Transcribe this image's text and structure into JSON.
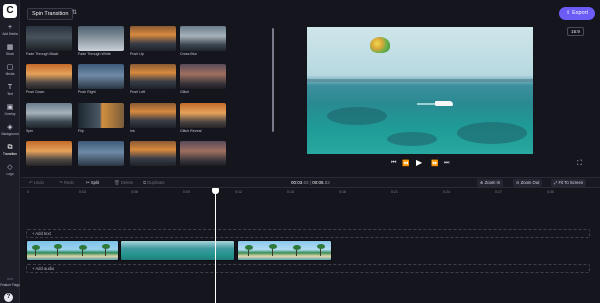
{
  "app": {
    "logo": "C"
  },
  "rail": {
    "items": [
      {
        "label": "Add Media",
        "icon": "+"
      },
      {
        "label": "Stock",
        "icon": "▦"
      },
      {
        "label": "Media",
        "icon": "▢"
      },
      {
        "label": "Text",
        "icon": "T"
      },
      {
        "label": "Overlay",
        "icon": "▣"
      },
      {
        "label": "Background",
        "icon": "◈"
      },
      {
        "label": "Transition",
        "icon": "⧉"
      },
      {
        "label": "Logo",
        "icon": "◇"
      }
    ],
    "active_index": 6,
    "feature_flags": {
      "label": "Feature Flags",
      "icon": "⋯"
    },
    "help_icon": "?"
  },
  "header": {
    "project_title": "Spin Transition",
    "rename_icon": "⇅",
    "export_label": "Export",
    "export_icon": "⇪",
    "ratio": "16:9"
  },
  "transitions": {
    "tiles": [
      {
        "label": "Fade Through Black",
        "style": "t-dark"
      },
      {
        "label": "Fade Through White",
        "style": "t-white"
      },
      {
        "label": "Push Up",
        "style": "t-sunset"
      },
      {
        "label": "Cross Blur",
        "style": "t-mtn"
      },
      {
        "label": "Push Down",
        "style": "t-warm"
      },
      {
        "label": "Push Right",
        "style": "t-blue"
      },
      {
        "label": "Push Left",
        "style": "t-sunset"
      },
      {
        "label": "Glitch",
        "style": "t-dusk"
      },
      {
        "label": "Spin",
        "style": "t-mtn"
      },
      {
        "label": "Flip",
        "style": "t-split"
      },
      {
        "label": "Ink",
        "style": "t-sunset"
      },
      {
        "label": "Glitch Reveal",
        "style": "t-warm"
      },
      {
        "label": "",
        "style": "t-warm"
      },
      {
        "label": "",
        "style": "t-blue"
      },
      {
        "label": "",
        "style": "t-sunset"
      },
      {
        "label": "",
        "style": "t-dusk"
      }
    ]
  },
  "player": {
    "skip_back_icon": "⏮",
    "rewind_icon": "⏪",
    "play_icon": "▶",
    "forward_icon": "⏩",
    "skip_forward_icon": "⏭",
    "fullscreen_icon": "⛶"
  },
  "toolbar": {
    "undo": "Undo",
    "redo": "Redo",
    "split": "Split",
    "delete": "Delete",
    "duplicate": "Duplicate",
    "time_current": "00:03",
    "time_current_frac": ".63",
    "time_separator": " | ",
    "time_total": "00:05",
    "time_total_frac": ".83",
    "zoom_in": "Zoom In",
    "zoom_out": "Zoom Out",
    "fit_to_screen": "Fit To Screen"
  },
  "ruler": {
    "ticks": [
      "0",
      "0:03",
      "0:06",
      "0:09",
      "0:12",
      "0:15",
      "0:18",
      "0:21",
      "0:24",
      "0:27",
      "0:30"
    ]
  },
  "tracks": {
    "text_label": "+ Add text",
    "audio_label": "+ Add audio"
  }
}
